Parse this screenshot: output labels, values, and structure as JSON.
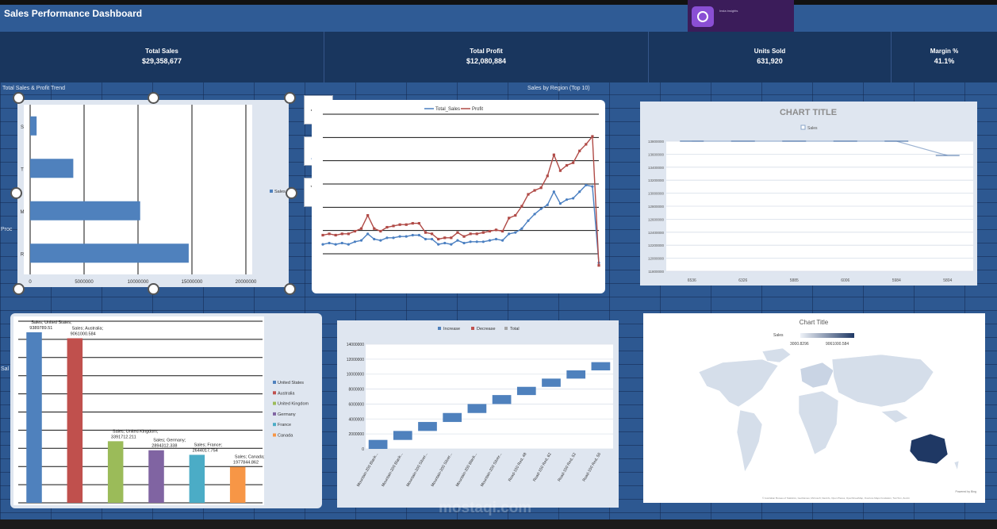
{
  "header": {
    "title": "Sales Performance Dashboard",
    "overlay_text": "Insta insights"
  },
  "kpis": [
    {
      "label": "Total Sales",
      "value": "$29,358,677"
    },
    {
      "label": "Total Profit",
      "value": "$12,080,884"
    },
    {
      "label": "Units Sold",
      "value": "631,920"
    },
    {
      "label": "Margin %",
      "value": "41.1%"
    }
  ],
  "sections": {
    "trend_label": "Total Sales & Profit Trend",
    "region_label": "Sales by Region (Top 10)",
    "side_label_1": "Proc",
    "side_label_2": "Sal"
  },
  "watermark": "mostaqi.com",
  "chart_data": [
    {
      "type": "bar",
      "orientation": "horizontal",
      "categories": [
        "R",
        "M",
        "T",
        "S"
      ],
      "series": [
        {
          "name": "Sales",
          "values": [
            14700000,
            10200000,
            4000000,
            600000
          ]
        }
      ],
      "xticks": [
        "0",
        "5000000",
        "10000000",
        "15000000",
        "20000000"
      ],
      "xlim": [
        0,
        20000000
      ],
      "legend": "right"
    },
    {
      "type": "line",
      "series": [
        {
          "name": "Total_Sales",
          "color": "#4a7fc1",
          "values": [
            18,
            19,
            18,
            19,
            18,
            20,
            21,
            26,
            22,
            21,
            23,
            23,
            24,
            24,
            25,
            25,
            22,
            22,
            18,
            19,
            18,
            21,
            19,
            20,
            20,
            20,
            21,
            22,
            21,
            26,
            27,
            30,
            36,
            41,
            45,
            48,
            58,
            49,
            52,
            53,
            58,
            63,
            62,
            4
          ]
        },
        {
          "name": "Profit",
          "color": "#b04a46",
          "values": [
            25,
            26,
            25,
            26,
            26,
            28,
            30,
            40,
            30,
            28,
            31,
            32,
            33,
            33,
            34,
            34,
            27,
            26,
            22,
            23,
            23,
            27,
            24,
            26,
            26,
            27,
            28,
            29,
            28,
            38,
            40,
            47,
            56,
            59,
            61,
            70,
            86,
            74,
            78,
            80,
            89,
            94,
            100,
            2
          ]
        }
      ],
      "ylim": [
        0,
        100
      ],
      "legend": "top"
    },
    {
      "type": "line",
      "title": "CHART TITLE",
      "categories": [
        "6536",
        "6326",
        "5885",
        "6006",
        "5984",
        "5804"
      ],
      "series": [
        {
          "name": "Sales",
          "values": [
            14730000,
            14620000,
            14380000,
            14000000,
            13950000,
            13580000
          ]
        }
      ],
      "yticks": [
        "11800000",
        "12000000",
        "12200000",
        "12400000",
        "12600000",
        "12800000",
        "13000000",
        "13200000",
        "13400000",
        "13600000",
        "13800000"
      ],
      "ylim": [
        11800000,
        15000000
      ],
      "legend": "top"
    },
    {
      "type": "bar",
      "categories": [
        "United States",
        "Australia",
        "United Kingdom",
        "Germany",
        "France",
        "Canada"
      ],
      "series": [
        {
          "name": "Sales",
          "values": [
            9389789.51,
            9061000.584,
            3391712.211,
            2894312.338,
            2644017.754,
            1977844.862
          ]
        }
      ],
      "colors": [
        "#4f81bd",
        "#c0504d",
        "#9bbb59",
        "#8064a2",
        "#4bacc6",
        "#f79646"
      ],
      "data_labels": [
        "Sales; United States; 9389789.51",
        "Sales; Australia; 9061000.584",
        "Sales; United Kingdom; 3391712.211",
        "Sales; Germany; 2894312.338",
        "Sales; France; 2644017.754",
        "Sales; Canada; 1977844.862"
      ],
      "ylim": [
        0,
        10000000
      ],
      "legend": "right"
    },
    {
      "type": "bar",
      "subtype": "waterfall",
      "legend_entries": [
        "Increase",
        "Decrease",
        "Total"
      ],
      "categories": [
        "Mountain-200 Black...",
        "Mountain-200 Black...",
        "Mountain-200 Silver...",
        "Mountain-200 Silver...",
        "Mountain-200 Black...",
        "Mountain-200 Silver...",
        "Road-150 Red, 48",
        "Road-150 Red, 62",
        "Road-150 Red, 52",
        "Road-150 Red, 56"
      ],
      "values": [
        1200000,
        1200000,
        1200000,
        1200000,
        1200000,
        1200000,
        1100000,
        1100000,
        1100000,
        1100000
      ],
      "yticks": [
        "0",
        "2000000",
        "4000000",
        "6000000",
        "8000000",
        "10000000",
        "12000000",
        "14000000"
      ],
      "ylim": [
        0,
        14000000
      ],
      "legend": "top"
    },
    {
      "type": "map",
      "title": "Chart Title",
      "legend_title": "Sales",
      "legend_min": "3000.8296",
      "legend_max": "9061000.584",
      "highlight_color": "#1f3864",
      "highlight": "Australia",
      "attribution": "Powered by Bing",
      "source": "© Australian Bureau of Statistics, GeoNames, Microsoft, Navinfo, Open Places, OpenStreetMap, Overture Maps Fundation, TomTom, Zenrin"
    }
  ]
}
